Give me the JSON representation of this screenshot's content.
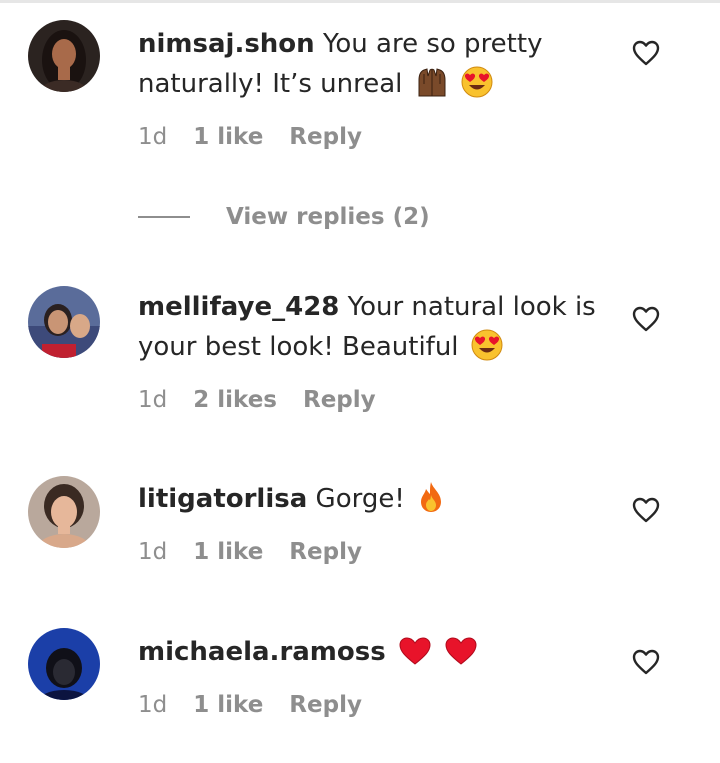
{
  "comments": [
    {
      "username": "nimsaj.shon",
      "text": "You are so pretty naturally! It’s unreal",
      "emojis": [
        "raising-hands-emoji",
        "heart-eyes-emoji"
      ],
      "time": "1d",
      "likes": "1 like",
      "reply_label": "Reply",
      "avatar_colors": {
        "bg": "#2b2320",
        "skin": "#a86a4a",
        "hair": "#1a1210"
      }
    },
    {
      "username": "mellifaye_428",
      "text": "Your natural look is your best look! Beautiful",
      "emojis": [
        "heart-eyes-emoji"
      ],
      "time": "1d",
      "likes": "2 likes",
      "reply_label": "Reply",
      "avatar_colors": {
        "bg": "#5a6c9a",
        "skin": "#c99575",
        "hair": "#2a2020"
      }
    },
    {
      "username": "litigatorlisa",
      "text": "Gorge!",
      "emojis": [
        "fire-emoji"
      ],
      "time": "1d",
      "likes": "1 like",
      "reply_label": "Reply",
      "avatar_colors": {
        "bg": "#b9a89c",
        "skin": "#e6b79a",
        "hair": "#3a2a22"
      }
    },
    {
      "username": "michaela.ramoss",
      "text": "",
      "emojis": [
        "red-heart-emoji",
        "red-heart-emoji"
      ],
      "time": "1d",
      "likes": "1 like",
      "reply_label": "Reply",
      "avatar_colors": {
        "bg": "#1b3fa8",
        "skin": "#2a2a33",
        "hair": "#101018"
      }
    }
  ],
  "view_replies": "View replies (2)",
  "colors": {
    "text": "#262626",
    "meta": "#8e8e8e",
    "heart_red": "#e8132a",
    "emoji_yellow": "#f9c22e"
  }
}
